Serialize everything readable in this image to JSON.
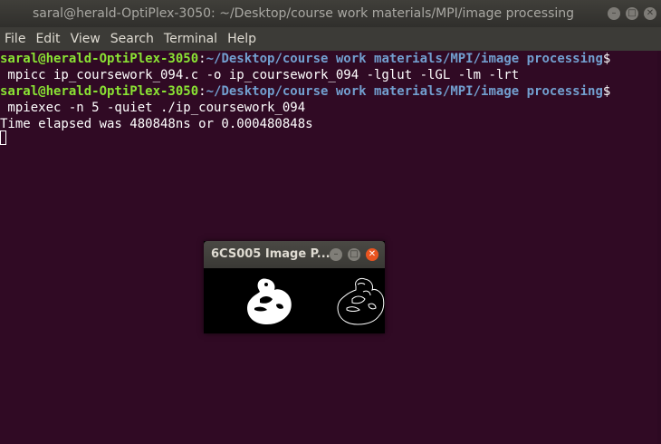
{
  "window": {
    "title": "saral@herald-OptiPlex-3050: ~/Desktop/course work materials/MPI/image processing"
  },
  "menu": [
    "File",
    "Edit",
    "View",
    "Search",
    "Terminal",
    "Help"
  ],
  "terminal": {
    "lines": [
      {
        "user_host": "saral@herald-OptiPlex-3050",
        "sep": ":",
        "path": "~/Desktop/course work materials/MPI/image processing",
        "suffix": "$"
      },
      {
        "text": " mpicc ip_coursework_094.c -o ip_coursework_094 -lglut -lGL -lm -lrt"
      },
      {
        "user_host": "saral@herald-OptiPlex-3050",
        "sep": ":",
        "path": "~/Desktop/course work materials/MPI/image processing",
        "suffix": "$"
      },
      {
        "text": " mpiexec -n 5 -quiet ./ip_coursework_094"
      },
      {
        "text": "Time elapsed was 480848ns or 0.000480848s"
      }
    ]
  },
  "popup": {
    "title": "6CS005 Image P..."
  },
  "colors": {
    "background": "#300a24",
    "prompt_user": "#8ae234",
    "prompt_path": "#729fcf",
    "close_button": "#e95420"
  },
  "icons": {
    "minimize": "minimize-icon",
    "maximize": "maximize-icon",
    "close": "close-icon"
  }
}
